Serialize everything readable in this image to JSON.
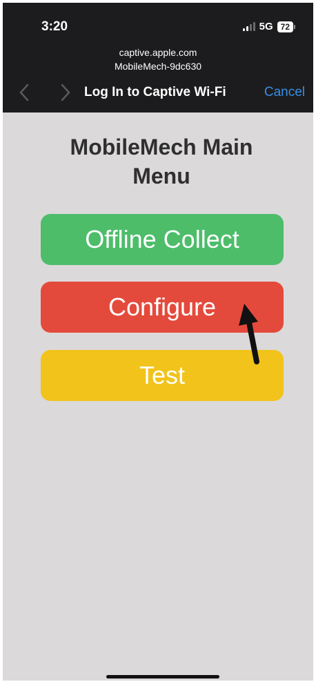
{
  "status_bar": {
    "time": "3:20",
    "network": "5G",
    "battery": "72"
  },
  "browser": {
    "url_line1": "captive.apple.com",
    "url_line2": "MobileMech-9dc630",
    "title": "Log In to Captive Wi-Fi",
    "cancel_label": "Cancel",
    "accent_color": "#3a8ee6"
  },
  "page": {
    "heading": "MobileMech Main Menu",
    "buttons": [
      {
        "label": "Offline Collect",
        "color": "#4dbd6a"
      },
      {
        "label": "Configure",
        "color": "#e44a3c"
      },
      {
        "label": "Test",
        "color": "#f1c31b"
      }
    ]
  },
  "icons": [
    "signal-icon",
    "battery-icon",
    "back-chevron-icon",
    "forward-chevron-icon",
    "pointer-arrow-icon"
  ]
}
